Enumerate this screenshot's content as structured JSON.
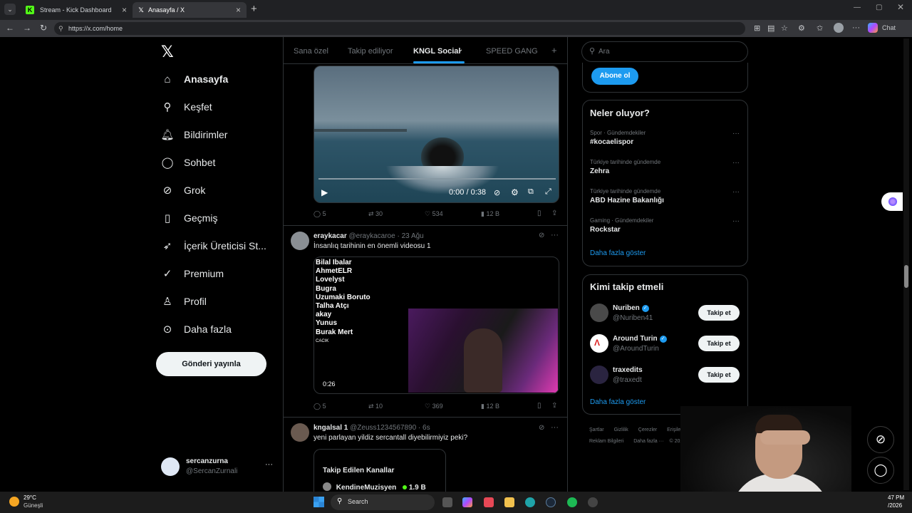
{
  "browser": {
    "tabs": [
      {
        "title": "Stream - Kick Dashboard",
        "favicon": "kick-icon"
      },
      {
        "title": "Anasayfa / X",
        "favicon": "x-icon"
      }
    ],
    "url": "https://x.com/home",
    "chat_label": "Chat"
  },
  "sidebar": {
    "items": [
      {
        "label": "Anasayfa",
        "icon": "home-icon"
      },
      {
        "label": "Keşfet",
        "icon": "search-icon"
      },
      {
        "label": "Bildirimler",
        "icon": "bell-icon"
      },
      {
        "label": "Sohbet",
        "icon": "chat-icon"
      },
      {
        "label": "Grok",
        "icon": "grok-icon"
      },
      {
        "label": "Geçmiş",
        "icon": "bookmark-icon"
      },
      {
        "label": "İçerik Üreticisi St...",
        "icon": "rocket-icon"
      },
      {
        "label": "Premium",
        "icon": "premium-icon"
      },
      {
        "label": "Profil",
        "icon": "person-icon"
      },
      {
        "label": "Daha fazla",
        "icon": "more-circle-icon"
      }
    ],
    "post_button": "Gönderi yayınla",
    "account": {
      "name": "sercanzurna",
      "handle": "@SercanZurnali"
    }
  },
  "feed": {
    "tabs": [
      "Sana özel",
      "Takip ediliyor",
      "KNGL Social",
      "SPEED GANG"
    ],
    "post1": {
      "video_time": "0:00 / 0:38",
      "replies": "5",
      "reposts": "30",
      "likes": "534",
      "views": "12 B"
    },
    "post2": {
      "name": "eraykacar",
      "handle": "@eraykacaroe",
      "time": "23 Ağu",
      "text": "İnsanlıq tarihinin en önemli videosu 1",
      "list": [
        "Bilal Ibalar",
        "AhmetELR",
        "Lovelyst",
        "Bugra",
        "Uzumaki Boruto",
        "Talha Atçı",
        "akay",
        "Yunus",
        "Burak Mert"
      ],
      "small": "CACIK",
      "duration": "0:26",
      "replies": "5",
      "reposts": "10",
      "likes": "369",
      "views": "12 B"
    },
    "post3": {
      "name": "kngalsal 1",
      "handle": "@Zeuss1234567890",
      "time": "6s",
      "text": "yeni parlayan yildiz sercantall diyebilirmiyiz peki?",
      "card_title": "Takip Edilen Kanallar",
      "card_row": "KendineMuzisyen",
      "card_count": "1.9 B"
    }
  },
  "right": {
    "search_placeholder": "Ara",
    "subscribe": "Abone ol",
    "trends_title": "Neler oluyor?",
    "trends": [
      {
        "meta": "Spor · Gündemdekiler",
        "name": "#kocaelispor"
      },
      {
        "meta": "Türkiye tarihinde gündemde",
        "name": "Zehra"
      },
      {
        "meta": "Türkiye tarihinde gündemde",
        "name": "ABD Hazine Bakanlığı"
      },
      {
        "meta": "Gaming · Gündemdekiler",
        "name": "Rockstar"
      }
    ],
    "show_more": "Daha fazla göster",
    "who_title": "Kimi takip etmeli",
    "who": [
      {
        "name": "Nuriben",
        "handle": "@Nuriben41"
      },
      {
        "name": "Around Turin",
        "handle": "@AroundTurin"
      },
      {
        "name": "traxedits",
        "handle": "@traxedt"
      }
    ],
    "follow": "Takip et",
    "footer": [
      "Şartlar",
      "Gizlilik",
      "Çerezler",
      "Erişilebilirlik",
      "Reklam Bilgileri",
      "Daha fazla ···",
      "© 2026 X Corp."
    ]
  },
  "taskbar": {
    "weather_temp": "29°C",
    "weather_desc": "Güneşli",
    "search": "Search",
    "time": "47 PM",
    "date": "/2026"
  }
}
